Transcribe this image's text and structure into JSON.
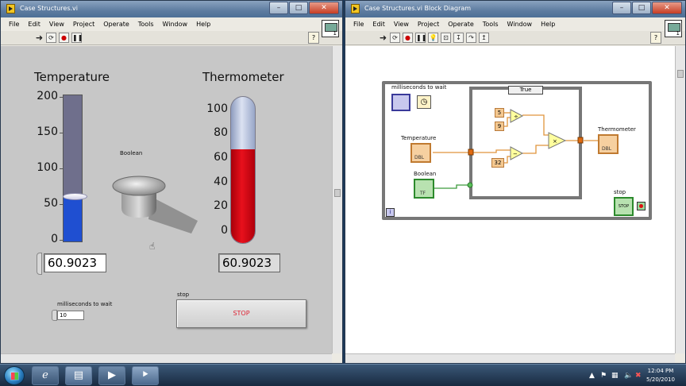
{
  "front_panel": {
    "title": "Case Structures.vi",
    "menu": [
      "File",
      "Edit",
      "View",
      "Project",
      "Operate",
      "Tools",
      "Window",
      "Help"
    ],
    "temperature": {
      "label": "Temperature",
      "scale": [
        "200",
        "150",
        "100",
        "50",
        "0"
      ],
      "value_text": "60.9023",
      "value": 60.9023,
      "max": 200,
      "fill_color": "#1f4fd1"
    },
    "thermometer": {
      "label": "Thermometer",
      "scale": [
        "100",
        "80",
        "60",
        "40",
        "20",
        "0"
      ],
      "value_text": "60.9023",
      "value": 60.9023,
      "max": 100,
      "fill_color": "#e8101c"
    },
    "boolean_label": "Boolean",
    "ms_wait": {
      "label": "milliseconds to wait",
      "value": "10"
    },
    "stop": {
      "label": "stop",
      "button_text": "STOP"
    }
  },
  "block_diagram": {
    "title": "Case Structures.vi Block Diagram",
    "menu": [
      "File",
      "Edit",
      "View",
      "Project",
      "Operate",
      "Tools",
      "Window",
      "Help"
    ],
    "case_selector": "True",
    "labels": {
      "ms_wait": "milliseconds to wait",
      "temperature": "Temperature",
      "thermometer": "Thermometer",
      "boolean": "Boolean",
      "stop": "stop"
    },
    "constants": [
      "5",
      "9",
      "32"
    ],
    "loop_index": "i",
    "stop_term": "STOP",
    "tf_term": "TF",
    "dbl_term": "DBL"
  },
  "taskbar": {
    "time": "12:04 PM",
    "date": "5/20/2010"
  }
}
